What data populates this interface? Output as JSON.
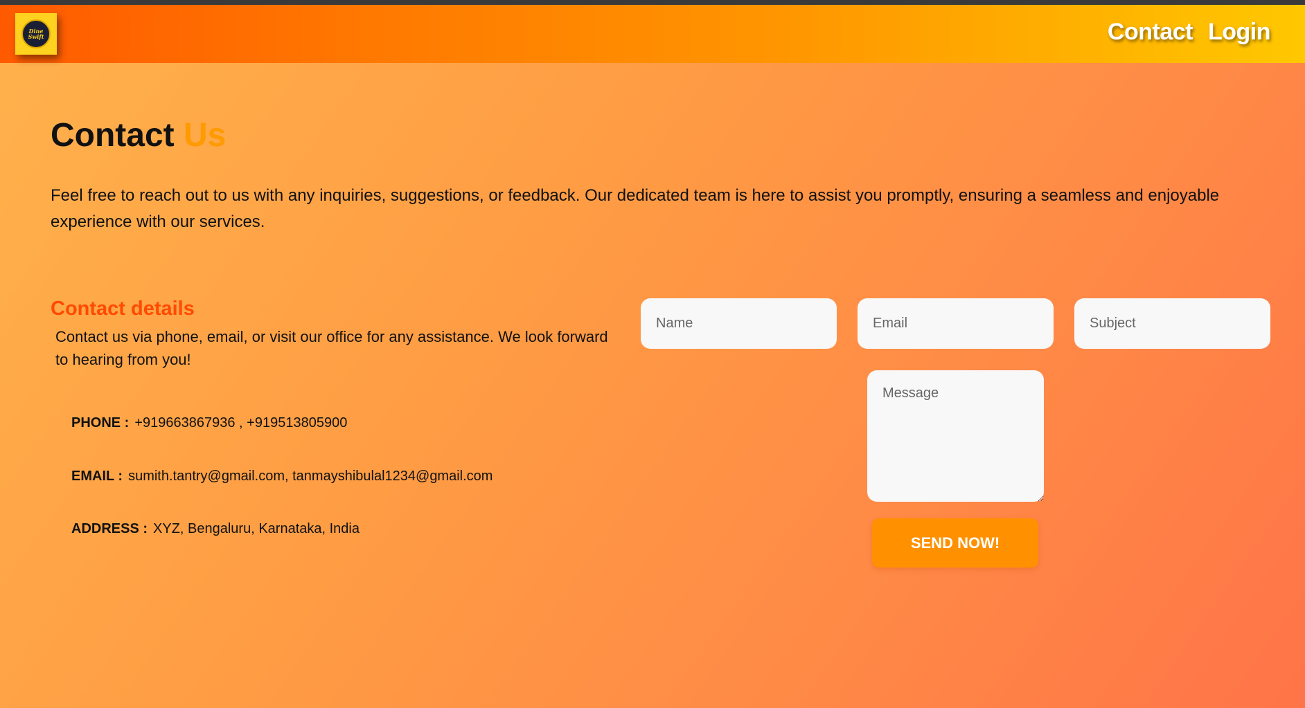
{
  "header": {
    "logo_text": [
      "Dine",
      "Swift"
    ],
    "nav": [
      {
        "label": "Contact"
      },
      {
        "label": "Login"
      }
    ]
  },
  "main": {
    "title_main": "Contact",
    "title_accent": "Us",
    "intro": "Feel free to reach out to us with any inquiries, suggestions, or feedback. Our dedicated team is here to assist you promptly, ensuring a seamless and enjoyable experience with our services."
  },
  "details": {
    "heading": "Contact details",
    "description": "Contact us via phone, email, or visit our office for any assistance. We look forward to hearing from you!",
    "items": [
      {
        "label": "PHONE :",
        "value": "+919663867936 , +919513805900"
      },
      {
        "label": "EMAIL :",
        "value": "sumith.tantry@gmail.com, tanmayshibulal1234@gmail.com"
      },
      {
        "label": "ADDRESS :",
        "value": "XYZ, Bengaluru, Karnataka, India"
      }
    ]
  },
  "form": {
    "name_placeholder": "Name",
    "email_placeholder": "Email",
    "subject_placeholder": "Subject",
    "message_placeholder": "Message",
    "submit_label": "SEND NOW!"
  },
  "colors": {
    "accent_orange": "#ff9a00",
    "heading_red_orange": "#ff4a00",
    "button_orange": "#ff9100",
    "logo_yellow": "#ffd21f"
  }
}
